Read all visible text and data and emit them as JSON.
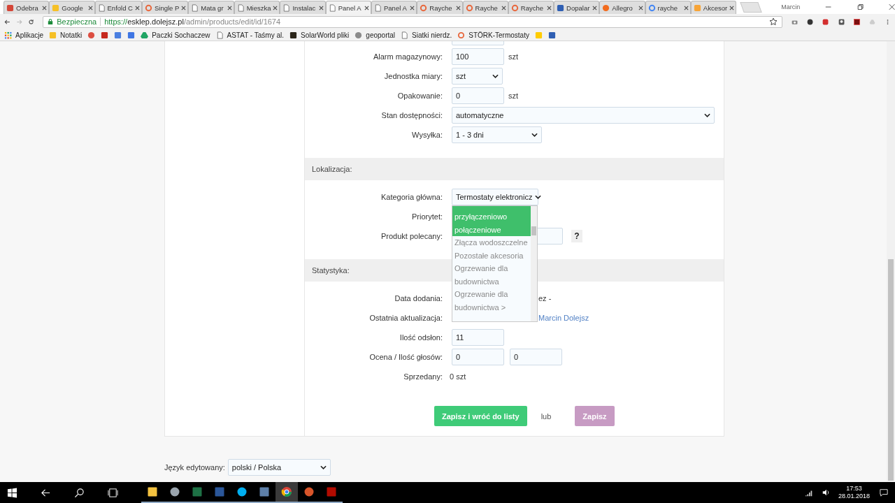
{
  "browser": {
    "tabs": [
      {
        "title": "Odebra",
        "selected": false
      },
      {
        "title": "Google",
        "selected": false
      },
      {
        "title": "Enfold C",
        "selected": false
      },
      {
        "title": "Single P",
        "selected": false
      },
      {
        "title": "Mata gr",
        "selected": false
      },
      {
        "title": "Mieszka",
        "selected": false
      },
      {
        "title": "Instalac",
        "selected": false
      },
      {
        "title": "Panel A",
        "selected": true
      },
      {
        "title": "Panel A",
        "selected": false
      },
      {
        "title": "Rayche",
        "selected": false
      },
      {
        "title": "Rayche",
        "selected": false
      },
      {
        "title": "Rayche",
        "selected": false
      },
      {
        "title": "Dopalar",
        "selected": false
      },
      {
        "title": "Allegro",
        "selected": false
      },
      {
        "title": "rayche",
        "selected": false
      },
      {
        "title": "Akcesor",
        "selected": false
      }
    ],
    "user": "Marcin",
    "address": {
      "security": "Bezpieczna",
      "scheme": "https://",
      "host": "esklep.dolejsz.pl",
      "path": "/admin/products/edit/id/1674"
    },
    "bookmarks": [
      "Aplikacje",
      "Notatki",
      "Paczki Sochaczew",
      "ASTAT - Taśmy al.",
      "SolarWorld pliki",
      "geoportal",
      "Siatki nierdz.",
      "STÖRK-Termostaty"
    ]
  },
  "sections": [
    {
      "rows": [
        {
          "label": "Alarm magazynowy:",
          "kind": "input",
          "value": "100",
          "unit": "szt"
        },
        {
          "label": "Jednostka miary:",
          "kind": "select-short",
          "value": "szt"
        },
        {
          "label": "Opakowanie:",
          "kind": "input",
          "value": "0",
          "unit": "szt"
        },
        {
          "label": "Stan dostępności:",
          "kind": "select-wide",
          "value": "automatyczne"
        },
        {
          "label": "Wysyłka:",
          "kind": "select-medium",
          "value": "1 - 3 dni"
        }
      ]
    },
    {
      "header": "Lokalizacja:",
      "rows": [
        {
          "label": "Kategoria główna:",
          "kind": "dropdown-open",
          "value": "Termostaty elektronicz",
          "options": [
            {
              "text": "przyłączeniowo połączeniowe",
              "selected": true
            },
            {
              "text": "Złącza wodoszczelne",
              "selected": false
            },
            {
              "text": "Pozostałe akcesoria",
              "selected": false
            },
            {
              "text": "Ogrzewanie dla budownictwa",
              "selected": false
            },
            {
              "text": "Ogrzewanie dla budownictwa >",
              "selected": false
            }
          ]
        },
        {
          "label": "Priorytet:",
          "kind": "covered"
        },
        {
          "label": "Produkt polecany:",
          "kind": "input-help",
          "help": "?"
        }
      ]
    },
    {
      "header": "Statystyka:",
      "rows": [
        {
          "label": "Data dodania:",
          "kind": "covered-text",
          "value": "ez -"
        },
        {
          "label": "Ostatnia aktualizacja:",
          "kind": "covered-link",
          "value": "Marcin Dolejsz"
        },
        {
          "label": "Ilość odsłon:",
          "kind": "input",
          "value": "11"
        },
        {
          "label": "Ocena / Ilość głosów:",
          "kind": "input-pair",
          "values": [
            "0",
            "0"
          ]
        },
        {
          "label": "Sprzedany:",
          "kind": "text",
          "value": "0 szt"
        }
      ]
    }
  ],
  "actions": {
    "primary": "Zapisz i wróć do listy",
    "separator": "lub",
    "secondary": "Zapisz"
  },
  "language": {
    "label": "Język edytowany:",
    "value": "polski / Polska"
  },
  "taskbar": {
    "apps": [
      {
        "selected": false
      },
      {
        "selected": false
      },
      {
        "selected": false
      },
      {
        "selected": false
      },
      {
        "selected": false
      },
      {
        "selected": false
      },
      {
        "selected": true
      },
      {
        "selected": false
      },
      {
        "selected": false
      }
    ],
    "time": "17:53",
    "date": "28.01.2018"
  }
}
